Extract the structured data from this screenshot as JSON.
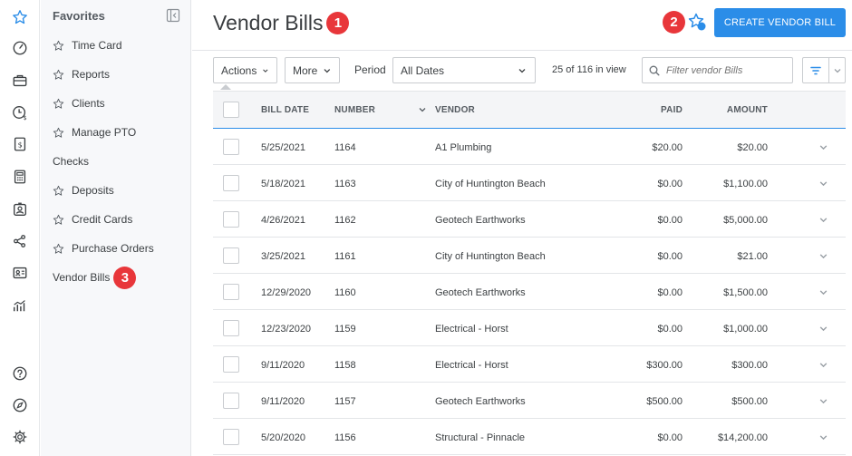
{
  "sidebar": {
    "title": "Favorites",
    "items": [
      {
        "label": "Time Card",
        "starred": true
      },
      {
        "label": "Reports",
        "starred": true
      },
      {
        "label": "Clients",
        "starred": true
      },
      {
        "label": "Manage PTO",
        "starred": true
      },
      {
        "label": "Checks",
        "starred": false
      },
      {
        "label": "Deposits",
        "starred": true
      },
      {
        "label": "Credit Cards",
        "starred": true
      },
      {
        "label": "Purchase Orders",
        "starred": true
      },
      {
        "label": "Vendor Bills",
        "starred": false
      }
    ]
  },
  "badges": {
    "one": "1",
    "two": "2",
    "three": "3"
  },
  "header": {
    "title": "Vendor Bills",
    "create_label": "CREATE VENDOR BILL"
  },
  "toolbar": {
    "actions_label": "Actions",
    "more_label": "More",
    "period_label": "Period",
    "period_value": "All Dates",
    "in_view": "25 of 116 in view",
    "filter_placeholder": "Filter vendor Bills"
  },
  "table": {
    "columns": {
      "bill_date": "BILL DATE",
      "number": "NUMBER",
      "vendor": "VENDOR",
      "paid": "PAID",
      "amount": "AMOUNT"
    },
    "rows": [
      {
        "date": "5/25/2021",
        "number": "1164",
        "vendor": "A1 Plumbing",
        "paid": "$20.00",
        "amount": "$20.00"
      },
      {
        "date": "5/18/2021",
        "number": "1163",
        "vendor": "City of Huntington Beach",
        "paid": "$0.00",
        "amount": "$1,100.00"
      },
      {
        "date": "4/26/2021",
        "number": "1162",
        "vendor": "Geotech Earthworks",
        "paid": "$0.00",
        "amount": "$5,000.00"
      },
      {
        "date": "3/25/2021",
        "number": "1161",
        "vendor": "City of Huntington Beach",
        "paid": "$0.00",
        "amount": "$21.00"
      },
      {
        "date": "12/29/2020",
        "number": "1160",
        "vendor": "Geotech Earthworks",
        "paid": "$0.00",
        "amount": "$1,500.00"
      },
      {
        "date": "12/23/2020",
        "number": "1159",
        "vendor": "Electrical - Horst",
        "paid": "$0.00",
        "amount": "$1,000.00"
      },
      {
        "date": "9/11/2020",
        "number": "1158",
        "vendor": "Electrical - Horst",
        "paid": "$300.00",
        "amount": "$300.00"
      },
      {
        "date": "9/11/2020",
        "number": "1157",
        "vendor": "Geotech Earthworks",
        "paid": "$500.00",
        "amount": "$500.00"
      },
      {
        "date": "5/20/2020",
        "number": "1156",
        "vendor": "Structural - Pinnacle",
        "paid": "$0.00",
        "amount": "$14,200.00"
      }
    ]
  },
  "colors": {
    "accent": "#2b8de8",
    "badge": "#e8363a"
  }
}
